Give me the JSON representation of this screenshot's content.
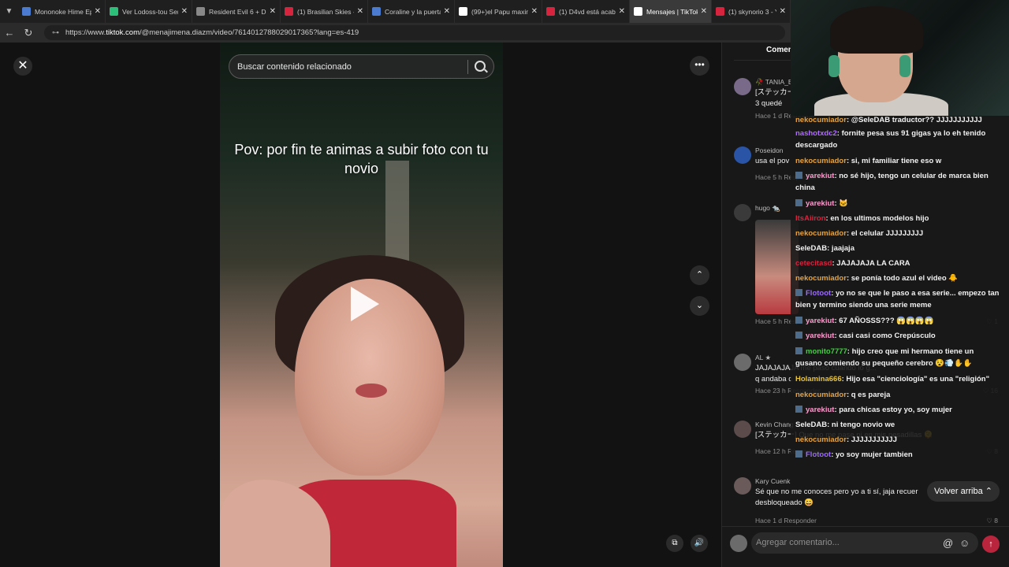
{
  "browser": {
    "tabs": [
      {
        "title": "Mononoke Hime Ep",
        "fav": "#4a7bd1"
      },
      {
        "title": "Ver Lodoss-tou Sen",
        "fav": "#2bbf7a"
      },
      {
        "title": "Resident Evil 6 + DL",
        "fav": "#888888"
      },
      {
        "title": "(1) Brasilian Skies -",
        "fav": "#d6243f"
      },
      {
        "title": "Coraline y la puerta",
        "fav": "#4a7bd1"
      },
      {
        "title": "(99+)el Papu maxim",
        "fav": "#ffffff"
      },
      {
        "title": "(1) D4vd está acaba",
        "fav": "#d6243f"
      },
      {
        "title": "Mensajes | TikTok",
        "fav": "#ffffff"
      },
      {
        "title": "(1) skynorio 3 - You",
        "fav": "#d6243f"
      }
    ],
    "url_prefix": "https://www.",
    "url_domain": "tiktok.com",
    "url_rest": "/@menajimena.diazm/video/7614012788029017365?lang=es-419"
  },
  "video": {
    "caption": "Pov: por fin te animas a subir foto con tu novio",
    "search_placeholder": "Buscar contenido relacionado",
    "close_glyph": "✕",
    "more_glyph": "•••",
    "up_glyph": "⌃",
    "down_glyph": "⌄",
    "ctrl1_glyph": "⧉",
    "ctrl2_glyph": "🔊"
  },
  "comments_panel": {
    "tab_label": "Comen",
    "comments": [
      {
        "name": "🥀 TANIA_E",
        "text": "[ステッカー",
        "text2": "3 quedé",
        "meta": "Hace 1 d   Responder",
        "likes": "",
        "color": "#7a6a8a"
      },
      {
        "name": "Poseidon",
        "text": "usa el pov",
        "text2": "",
        "meta": "Hace 5 h   Responder",
        "likes": "",
        "color": "#2a55a6"
      },
      {
        "name": "hugo 🐀",
        "text": "",
        "text2": "",
        "meta": "Hace 5 h   Responder",
        "likes": "♡ 1",
        "color": "#3a3a3a"
      },
      {
        "name": "AL ★",
        "text": "JAJAJAJAJA me pasó cuando lo g...",
        "text2": "q andaba c",
        "meta": "Hace 23 h   Responder",
        "likes": "♡ 16",
        "color": "#6b6b6b"
      },
      {
        "name": "Kevin Chang",
        "text": "[ステッカー] Que no me pase ni en mis pesadillas 🫠",
        "text2": "",
        "meta": "Hace 12 h   Responder",
        "likes": "♡ 8",
        "color": "#5b4b4b"
      },
      {
        "name": "Kary Cuenk",
        "text": "Sé que no me conoces pero yo a ti sí, jaja recuer",
        "text2": "desbloqueado 😄",
        "meta": "Hace 1 d   Responder",
        "likes": "♡ 8",
        "color": "#6a5a5a"
      }
    ],
    "volver_label": "Volver arriba ⌃",
    "composer_placeholder": "Agregar comentario...",
    "at_icon": "@",
    "emoji_icon": "☺",
    "send_icon": "↑"
  },
  "chat": {
    "messages": [
      {
        "user": "nekocumiador",
        "color": "#e8a33b",
        "text": ": @SeleDAB traductor?? JJJJJJJJJJJ",
        "badge": false
      },
      {
        "user": "nashotxdc2",
        "color": "#b06bff",
        "text": ": fornite pesa sus 91 gigas ya lo eh tenido descargado",
        "badge": false
      },
      {
        "user": "nekocumiador",
        "color": "#e8a33b",
        "text": ": si, mi familiar tiene eso w",
        "badge": false
      },
      {
        "user": "yarekiut",
        "color": "#ff9ccf",
        "text": ": no sé hijo, tengo un celular de marca bien china",
        "badge": true
      },
      {
        "user": "yarekiut",
        "color": "#ff9ccf",
        "text": ": 🐱",
        "badge": true
      },
      {
        "user": "ItsAiiron",
        "color": "#d6243f",
        "text": ": en los ultimos modelos hijo",
        "badge": false
      },
      {
        "user": "nekocumiador",
        "color": "#e8a33b",
        "text": ": el celular JJJJJJJJJ",
        "badge": false
      },
      {
        "user": "SeleDAB",
        "color": "#f2f2f2",
        "text": ": jaajaja",
        "badge": false
      },
      {
        "user": "cetecitasd",
        "color": "#d6243f",
        "text": ": JAJAJAJA LA CARA",
        "badge": false
      },
      {
        "user": "nekocumiador",
        "color": "#e8a33b",
        "text": ": se ponía todo azul el video 🐥",
        "badge": false
      },
      {
        "user": "Flotoot",
        "color": "#9b6bff",
        "text": ": yo no se que le paso a esa serie... empezo tan bien y termino siendo una serie meme",
        "badge": true
      },
      {
        "user": "yarekiut",
        "color": "#ff9ccf",
        "text": ": 67 AÑOSSS??? 😱😱😱😱",
        "badge": true
      },
      {
        "user": "yarekiut",
        "color": "#ff9ccf",
        "text": ": casi casi como Crepúsculo",
        "badge": true
      },
      {
        "user": "monito7777",
        "color": "#3fd13f",
        "text": ": hijo creo que mi hermano tiene un gusano comiendo su pequeño cerebro 😵💨✋✋",
        "badge": true
      },
      {
        "user": "Holamina666",
        "color": "#e8c43b",
        "text": ": Hijo esa \"cienciología\" es una \"religión\"",
        "badge": false
      },
      {
        "user": "nekocumiador",
        "color": "#e8a33b",
        "text": ": q es pareja",
        "badge": false
      },
      {
        "user": "yarekiut",
        "color": "#ff9ccf",
        "text": ": para chicas estoy yo, soy mujer",
        "badge": true
      },
      {
        "user": "SeleDAB",
        "color": "#f2f2f2",
        "text": ": ni tengo novio we",
        "badge": false
      },
      {
        "user": "nekocumiador",
        "color": "#e8a33b",
        "text": ": JJJJJJJJJJJ",
        "badge": false
      },
      {
        "user": "Flotoot",
        "color": "#9b6bff",
        "text": ": yo soy mujer tambien",
        "badge": true
      }
    ]
  }
}
